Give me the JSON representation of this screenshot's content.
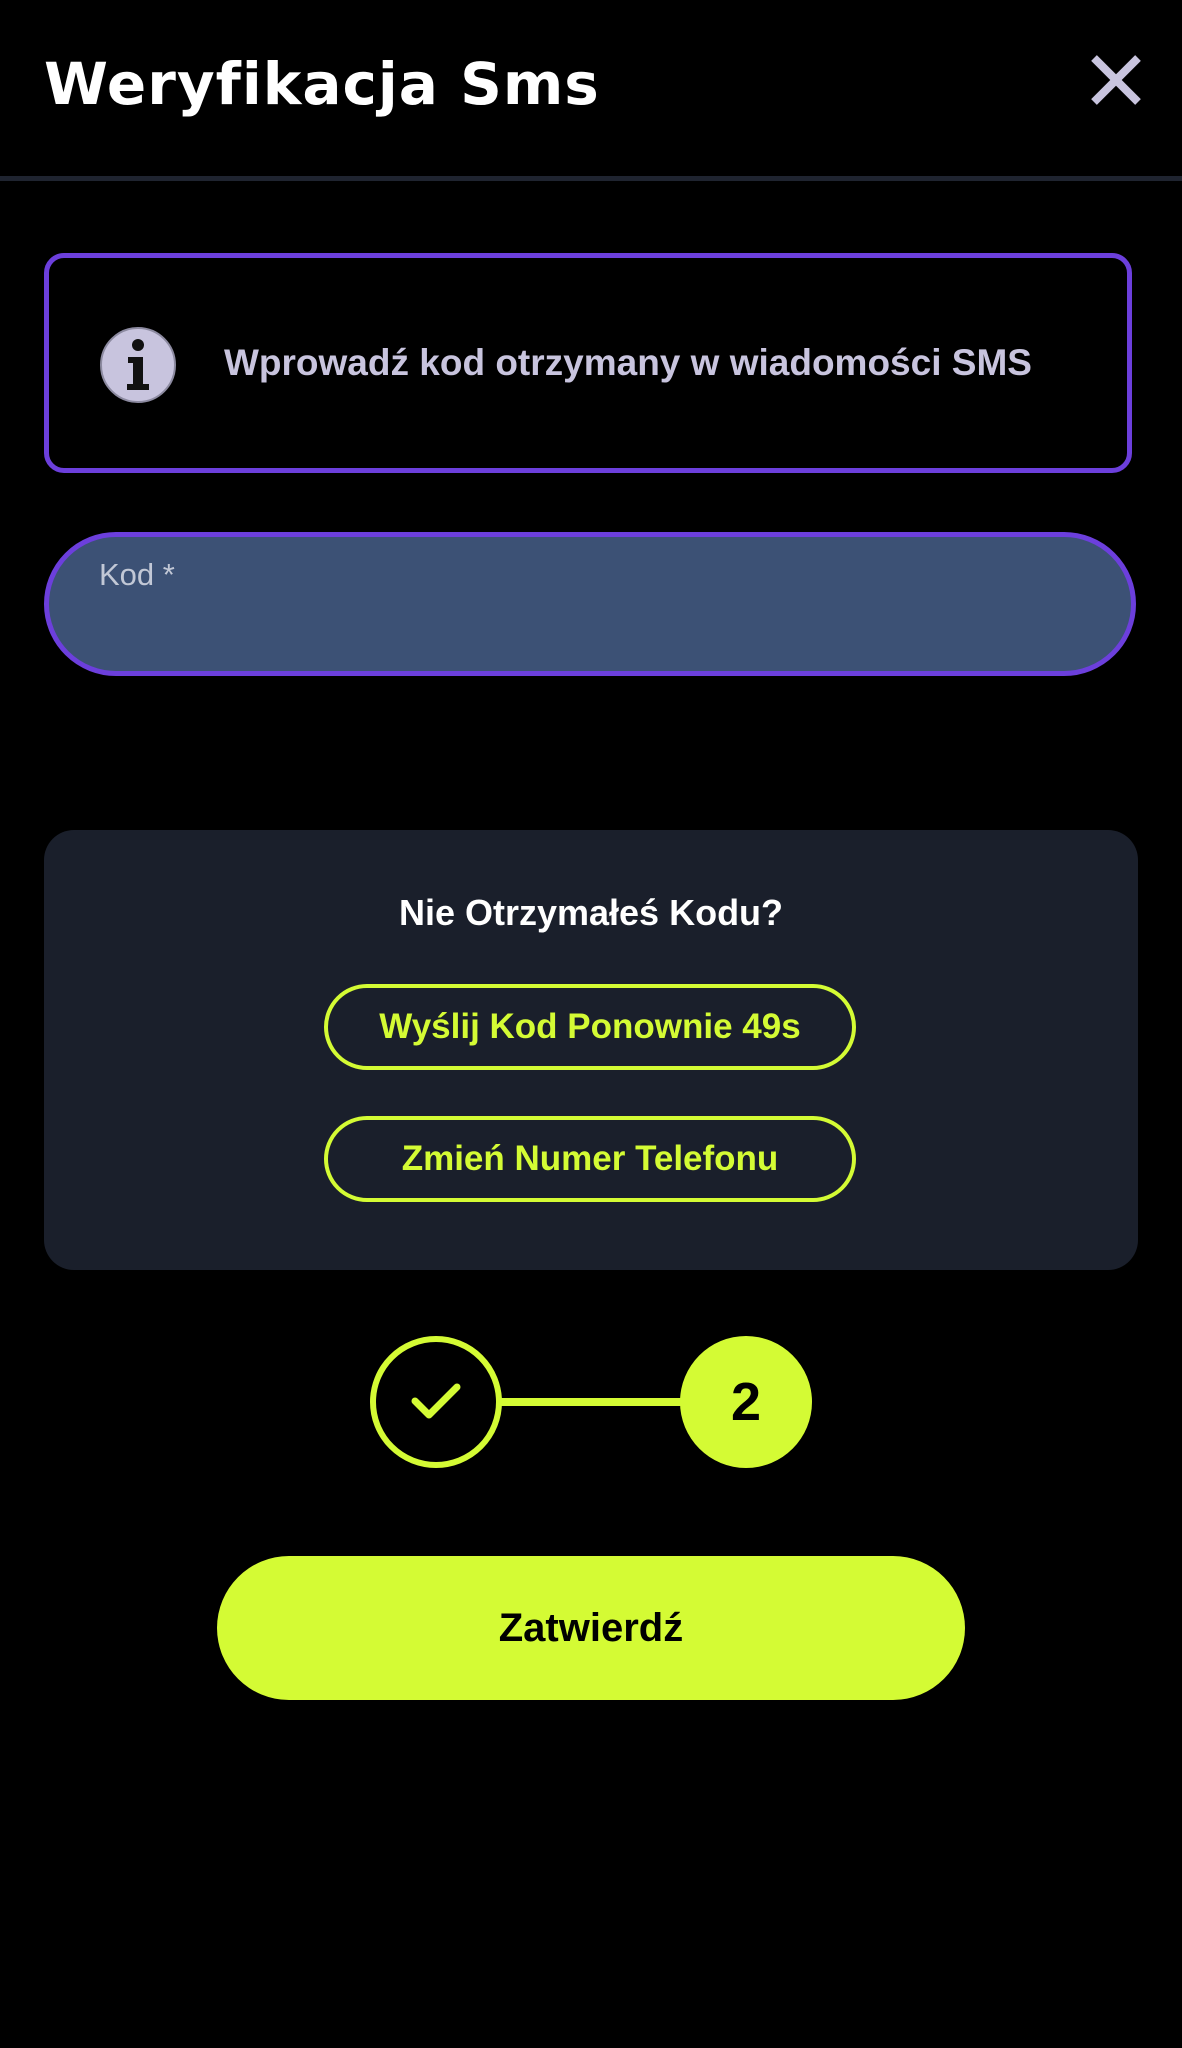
{
  "header": {
    "title": "Weryfikacja Sms",
    "close_icon": "close-icon"
  },
  "info": {
    "icon": "info-icon",
    "text": "Wprowadź kod otrzymany w wiadomości SMS"
  },
  "code_field": {
    "label": "Kod *",
    "value": ""
  },
  "resend": {
    "title": "Nie Otrzymałeś Kodu?",
    "resend_button": "Wyślij Kod Ponownie 49s",
    "change_phone_button": "Zmień Numer Telefonu"
  },
  "stepper": {
    "completed_icon": "check-icon",
    "current_step": "2"
  },
  "submit": {
    "label": "Zatwierdź"
  },
  "colors": {
    "accent": "#d4fb34",
    "border_purple": "#6c3fdc",
    "field_bg": "#3c5175",
    "panel_bg": "#1a1f2b",
    "background": "#000000"
  }
}
